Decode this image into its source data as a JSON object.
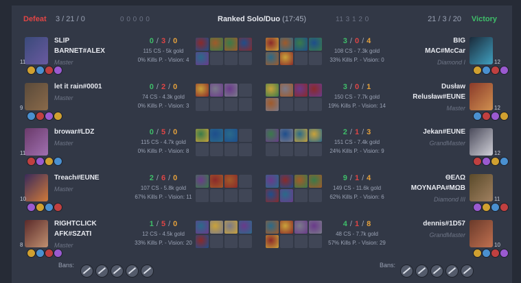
{
  "header": {
    "left_result": "Defeat",
    "left_kda": "3 / 21 / 0",
    "mode": "Ranked Solo/Duo",
    "duration": "(17:45)",
    "right_kda": "21 / 3 / 20",
    "right_result": "Victory",
    "left_objectives": "0  0  0  0  0",
    "right_objectives": "11  3  1  2  0"
  },
  "left": [
    {
      "name_line1": "SLIP",
      "name_line2": "BARNET#ALEX",
      "rank": "Master",
      "level": "11",
      "k": "0",
      "d": "3",
      "a": "0",
      "cs": "115 CS - 5k gold",
      "kp": "0% Kills P. - Vision: 4"
    },
    {
      "name_line1": "let it rain#0001",
      "name_line2": "",
      "rank": "Master",
      "level": "9",
      "k": "0",
      "d": "2",
      "a": "0",
      "cs": "74 CS - 4.3k gold",
      "kp": "0% Kills P. - Vision: 3"
    },
    {
      "name_line1": "browar#LDZ",
      "name_line2": "",
      "rank": "Master",
      "level": "11",
      "k": "0",
      "d": "5",
      "a": "0",
      "cs": "115 CS - 4.7k gold",
      "kp": "0% Kills P. - Vision: 8"
    },
    {
      "name_line1": "Treach#EUNE",
      "name_line2": "",
      "rank": "Master",
      "level": "10",
      "k": "2",
      "d": "6",
      "a": "0",
      "cs": "107 CS - 5.8k gold",
      "kp": "67% Kills P. - Vision: 11"
    },
    {
      "name_line1": "RIGHTCLICK",
      "name_line2": "AFK#SZATI",
      "rank": "Master",
      "level": "8",
      "k": "1",
      "d": "5",
      "a": "0",
      "cs": "12 CS - 4.5k gold",
      "kp": "33% Kills P. - Vision: 20"
    }
  ],
  "right": [
    {
      "name_line1": "BIG",
      "name_line2": "MAC#McCar",
      "rank": "Diamond I",
      "level": "12",
      "k": "3",
      "d": "0",
      "a": "4",
      "cs": "108 CS - 7.3k gold",
      "kp": "33% Kills P. - Vision: 0"
    },
    {
      "name_line1": "Dusław",
      "name_line2": "Relusław#EUNE",
      "rank": "Master",
      "level": "12",
      "k": "3",
      "d": "0",
      "a": "1",
      "cs": "150 CS - 7.7k gold",
      "kp": "19% Kills P. - Vision: 14"
    },
    {
      "name_line1": "Jekan#EUNE",
      "name_line2": "",
      "rank": "GrandMaster",
      "level": "12",
      "k": "2",
      "d": "1",
      "a": "3",
      "cs": "151 CS - 7.4k gold",
      "kp": "24% Kills P. - Vision: 9"
    },
    {
      "name_line1": "ΘΕΛΩ",
      "name_line2": "ΜΟΥΝΑΡΑ#ΜΩΒ",
      "rank": "Diamond III",
      "level": "11",
      "k": "9",
      "d": "1",
      "a": "4",
      "cs": "149 CS - 11.6k gold",
      "kp": "62% Kills P. - Vision: 6"
    },
    {
      "name_line1": "dennis#1D57",
      "name_line2": "",
      "rank": "GrandMaster",
      "level": "10",
      "k": "4",
      "d": "1",
      "a": "8",
      "cs": "48 CS - 7.7k gold",
      "kp": "57% Kills P. - Vision: 29"
    }
  ],
  "bans_label": "Bans:",
  "colors": {
    "defeat": "#e04545",
    "victory": "#3fbf6a",
    "kills": "#3fbf6a",
    "deaths": "#e04545",
    "assists": "#e5a13c",
    "panel": "#323846",
    "background": "#262b36"
  },
  "icons": {
    "objectives": [
      "turret-icon",
      "inhibitor-icon",
      "dragon-icon",
      "herald-icon",
      "baron-icon"
    ]
  }
}
